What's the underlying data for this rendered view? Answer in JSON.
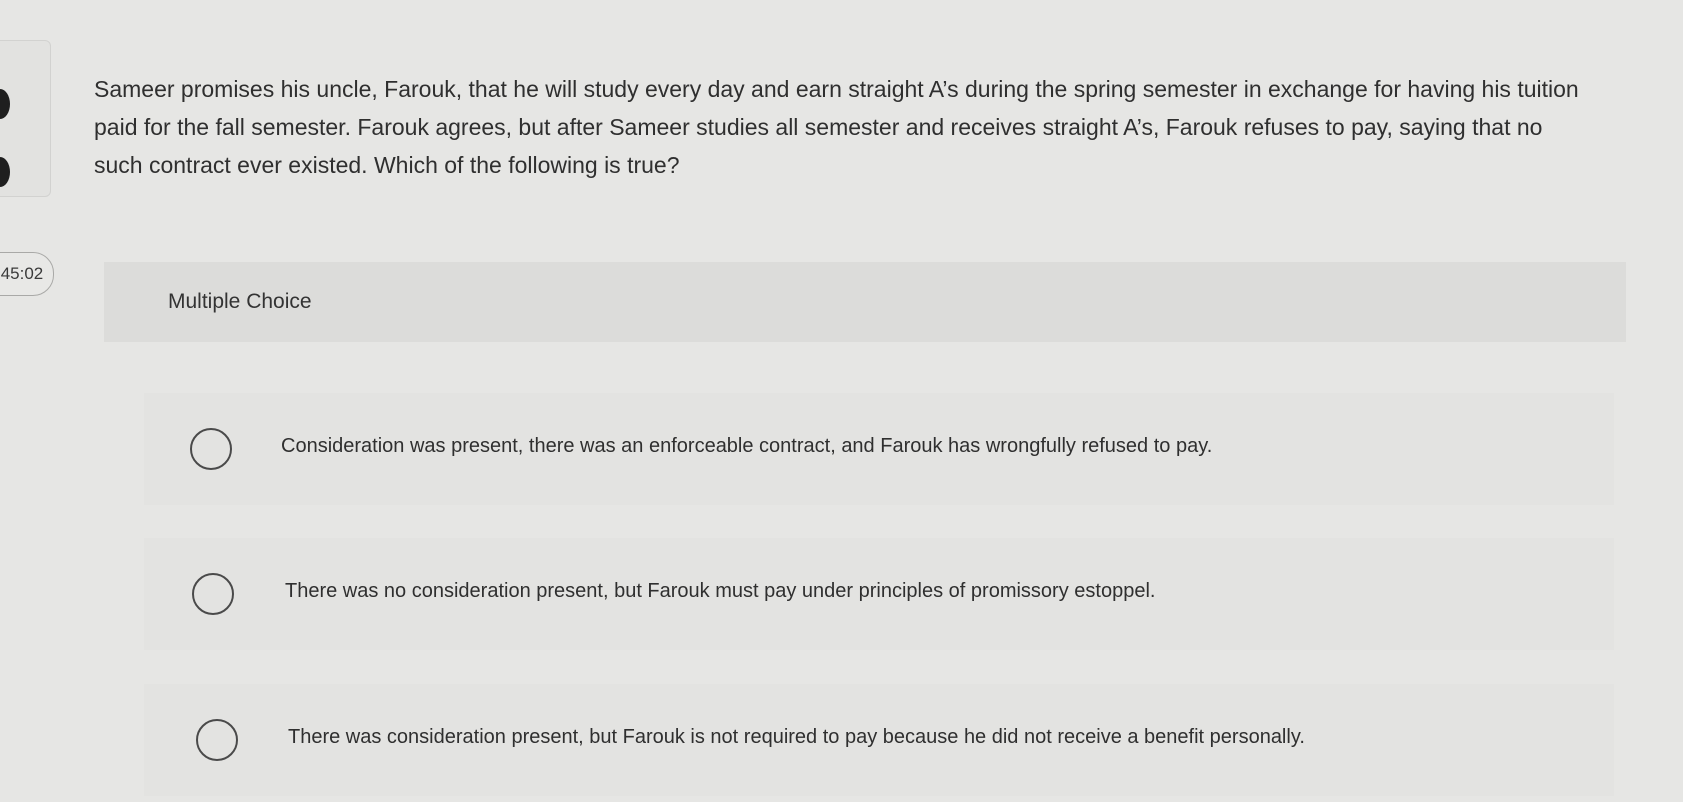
{
  "timer": {
    "text": "45:02"
  },
  "question": {
    "text": "Sameer promises his uncle, Farouk, that he will study every day and earn straight A’s during the spring semester in exchange for having his tuition paid for the fall semester. Farouk agrees, but after Sameer studies all semester and receives straight A’s, Farouk refuses to pay, saying that no such contract ever existed. Which of the following is true?"
  },
  "question_type": {
    "label": "Multiple Choice"
  },
  "options": [
    {
      "text": "Consideration was present, there was an enforceable contract, and Farouk has wrongfully refused to pay."
    },
    {
      "text": "There was no consideration present, but Farouk must pay under principles of promissory estoppel."
    },
    {
      "text": "There was consideration present, but Farouk is not required to pay because he did not receive a benefit personally."
    }
  ]
}
